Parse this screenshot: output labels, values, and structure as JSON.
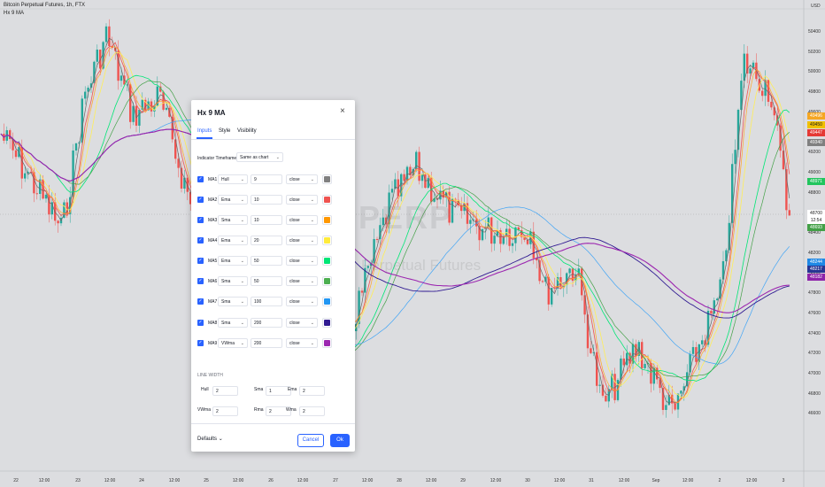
{
  "header": {
    "symbol_line": "Bitcoin Perpetual Futures, 1h, FTX",
    "indicator_line": "Hx 9 MA",
    "currency": "USD"
  },
  "watermark": {
    "big": "PERP",
    "small": "Perpetual Futures"
  },
  "price_axis": [
    "50400",
    "50200",
    "50000",
    "49800",
    "49600",
    "49400",
    "49200",
    "49000",
    "48800",
    "48600",
    "48400",
    "48200",
    "48000",
    "47800",
    "47600",
    "47400",
    "47200",
    "47000",
    "46800",
    "46600"
  ],
  "price_labels": [
    {
      "text": "49496",
      "color": "#f5a623"
    },
    {
      "text": "49450",
      "color": "#f0c000"
    },
    {
      "text": "49447",
      "color": "#e53935"
    },
    {
      "text": "49340",
      "color": "#808080"
    },
    {
      "text": "48971",
      "color": "#22c55e"
    },
    {
      "text": "48700",
      "color": "#ffffff"
    },
    {
      "text": "12:54",
      "color": "#ffffff"
    },
    {
      "text": "48693",
      "color": "#43a047"
    },
    {
      "text": "48244",
      "color": "#1e88e5"
    },
    {
      "text": "48217",
      "color": "#283593"
    },
    {
      "text": "48182",
      "color": "#8e24aa"
    }
  ],
  "time_axis": [
    "22",
    "12:00",
    "23",
    "12:00",
    "24",
    "12:00",
    "25",
    "12:00",
    "26",
    "12:00",
    "27",
    "12:00",
    "28",
    "12:00",
    "29",
    "12:00",
    "30",
    "12:00",
    "31",
    "12:00",
    "Sep",
    "12:00",
    "2",
    "12:00",
    "3"
  ],
  "dialog": {
    "title": "Hx 9 MA",
    "close_icon": "×",
    "tabs": [
      "Inputs",
      "Style",
      "Visibility"
    ],
    "timeframe_label": "Indicator Timeframe",
    "timeframe_value": "Same as chart",
    "rows": [
      {
        "label": "MA1",
        "type": "Hull",
        "length": "9",
        "source": "close",
        "color": "#808080"
      },
      {
        "label": "MA2",
        "type": "Ema",
        "length": "10",
        "source": "close",
        "color": "#ef5350"
      },
      {
        "label": "MA3",
        "type": "Sma",
        "length": "10",
        "source": "close",
        "color": "#ff9800"
      },
      {
        "label": "MA4",
        "type": "Ema",
        "length": "20",
        "source": "close",
        "color": "#ffeb3b"
      },
      {
        "label": "MA5",
        "type": "Ema",
        "length": "50",
        "source": "close",
        "color": "#00e676"
      },
      {
        "label": "MA6",
        "type": "Sma",
        "length": "50",
        "source": "close",
        "color": "#4caf50"
      },
      {
        "label": "MA7",
        "type": "Sma",
        "length": "100",
        "source": "close",
        "color": "#2196f3"
      },
      {
        "label": "MA8",
        "type": "Sma",
        "length": "200",
        "source": "close",
        "color": "#311b92"
      },
      {
        "label": "MA9",
        "type": "VWma",
        "length": "200",
        "source": "close",
        "color": "#9c27b0"
      }
    ],
    "line_width_title": "LINE WIDTH",
    "line_widths": [
      {
        "label": "Hull",
        "value": "2"
      },
      {
        "label": "Sma",
        "value": "1"
      },
      {
        "label": "Ema",
        "value": "2"
      },
      {
        "label": "VWma",
        "value": "2"
      },
      {
        "label": "Rma",
        "value": "2"
      },
      {
        "label": "Wma",
        "value": "2"
      }
    ],
    "defaults_label": "Defaults",
    "cancel_label": "Cancel",
    "ok_label": "Ok"
  }
}
